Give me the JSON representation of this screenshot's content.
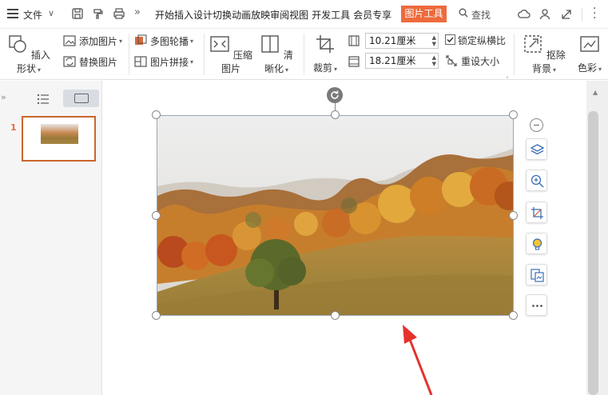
{
  "menubar": {
    "file_label": "文件",
    "tabs": [
      "开始",
      "插入",
      "设计",
      "切换",
      "动画",
      "放映",
      "审阅",
      "视图",
      "开发工具",
      "会员专享"
    ],
    "active_tab": "图片工具",
    "search_label": "查找"
  },
  "ribbon": {
    "insert_shape": "插入形状",
    "add_image": "添加图片",
    "replace_image": "替换图片",
    "carousel": "多图轮播",
    "image_stitch": "图片拼接",
    "compress": "压缩图片",
    "sharpen": "清晰化",
    "crop": "裁剪",
    "width_value": "10.21厘米",
    "height_value": "18.21厘米",
    "lock_ratio": "锁定纵横比",
    "reset_size": "重设大小",
    "remove_bg": "抠除背景",
    "color": "色彩"
  },
  "slides_panel": {
    "slide_number": "1"
  },
  "colors": {
    "accent": "#ee6a3c",
    "arrow": "#e5322d"
  }
}
